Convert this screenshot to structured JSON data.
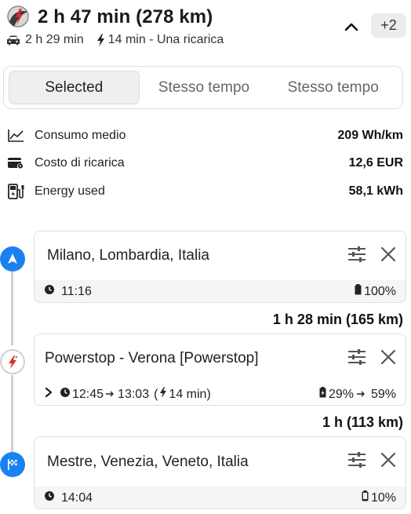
{
  "header": {
    "title": "2 h 47 min (278 km)",
    "drive_time": "2 h 29 min",
    "charge_summary": "14 min - Una ricarica",
    "more_badge": "+2"
  },
  "tabs": [
    {
      "label": "Selected",
      "active": true
    },
    {
      "label": "Stesso tempo",
      "active": false
    },
    {
      "label": "Stesso tempo",
      "active": false
    }
  ],
  "stats": [
    {
      "icon": "chart-line-icon",
      "label": "Consumo medio",
      "value": "209 Wh/km"
    },
    {
      "icon": "wallet-icon",
      "label": "Costo di ricarica",
      "value": "12,6 EUR"
    },
    {
      "icon": "charging-station-icon",
      "label": "Energy used",
      "value": "58,1 kWh"
    }
  ],
  "stops": [
    {
      "name": "Milano, Lombardia, Italia",
      "time": "11:16",
      "battery": "100%"
    },
    {
      "name": "Powerstop - Verona [Powerstop]",
      "arrive": "12:45",
      "depart": "13:03",
      "charge_open": "(",
      "charge_time": "14 min)",
      "battery_in": "29%",
      "battery_out": "59%"
    },
    {
      "name": "Mestre, Venezia, Veneto, Italia",
      "time": "14:04",
      "battery": "10%"
    }
  ],
  "legs": [
    "1 h 28 min (165 km)",
    "1 h (113 km)"
  ],
  "colors": {
    "accent": "#1a82f0",
    "brand_red": "#e0282b",
    "line": "#d0d0d0"
  }
}
